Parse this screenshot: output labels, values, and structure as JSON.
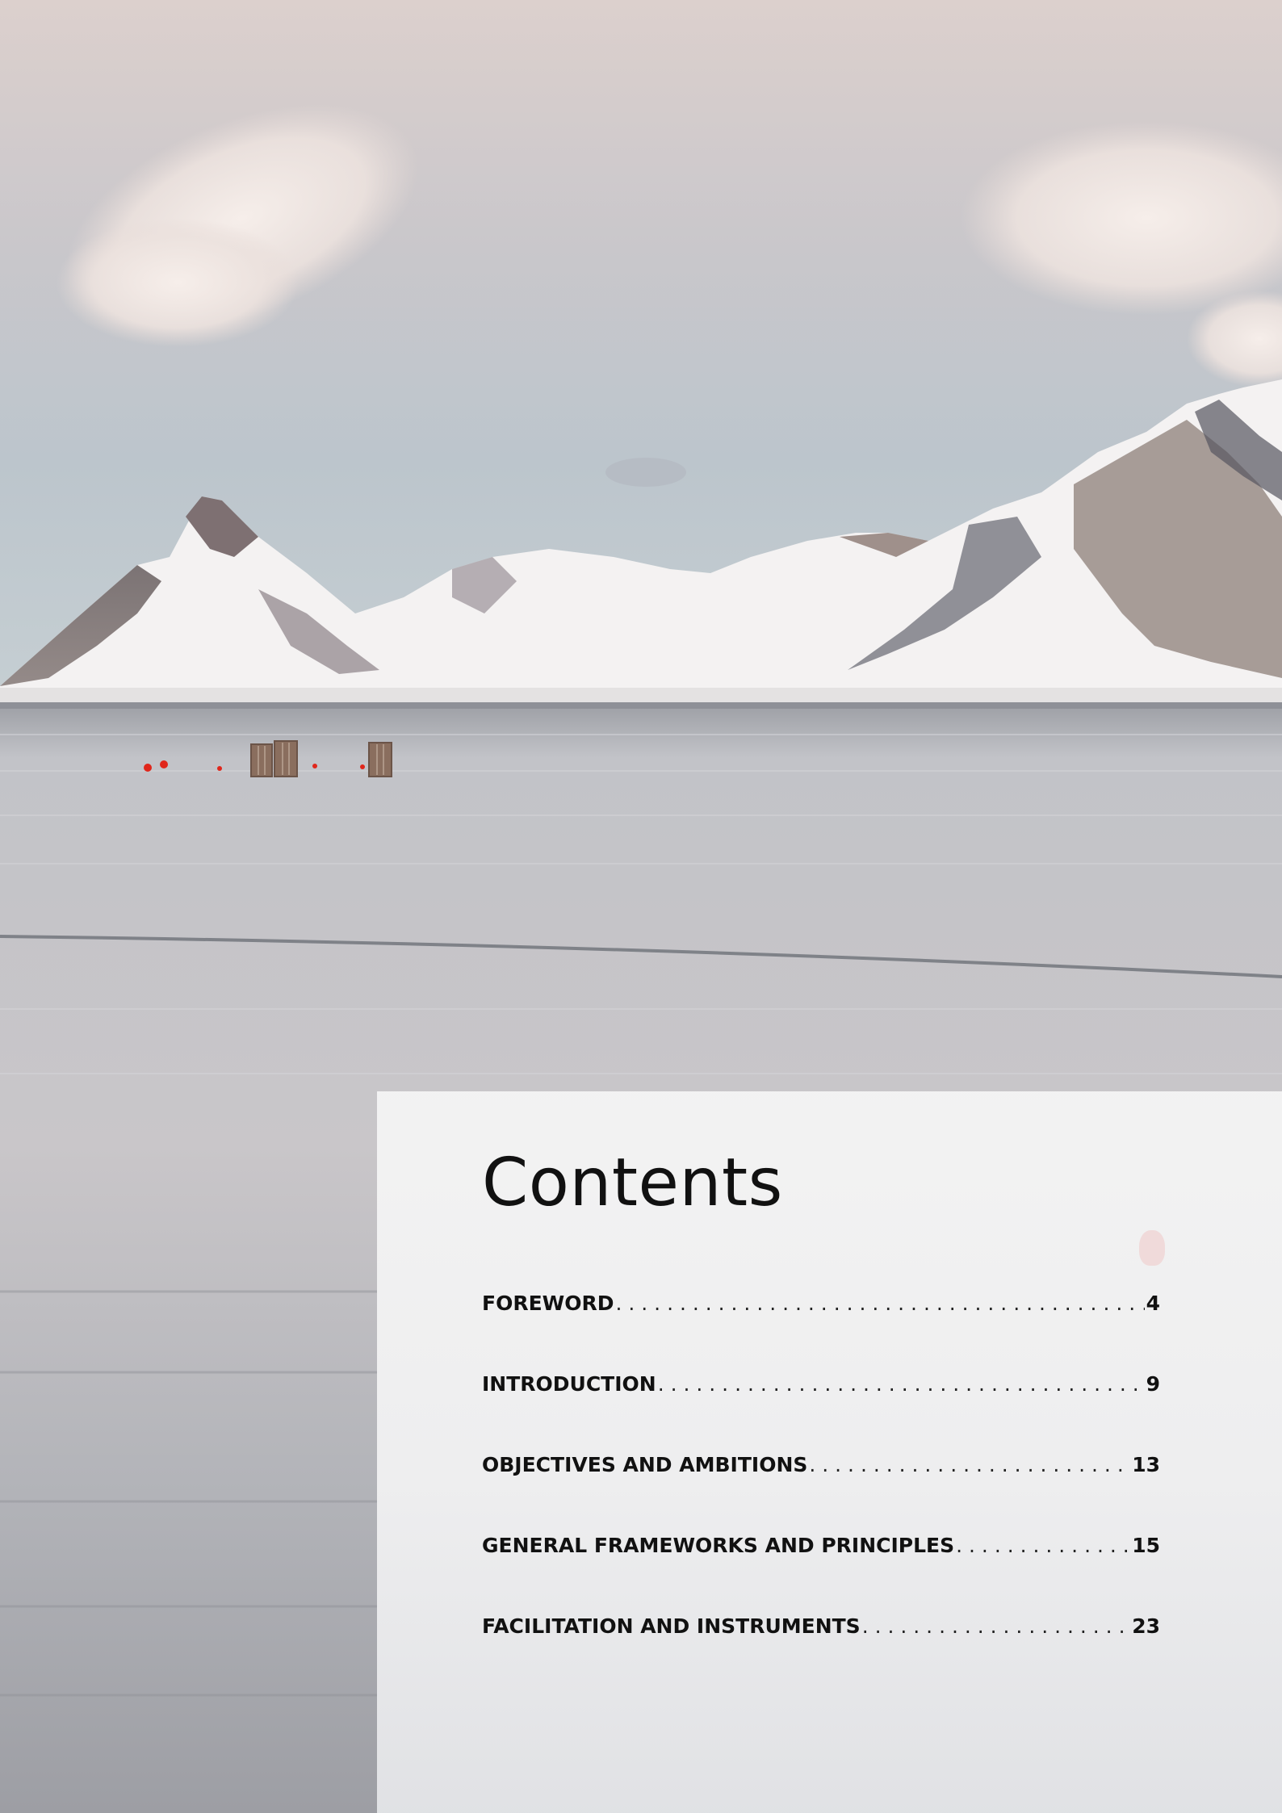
{
  "document": {
    "title": "Contents",
    "toc": [
      {
        "label": "FOREWORD",
        "page": "4"
      },
      {
        "label": "INTRODUCTION",
        "page": "9"
      },
      {
        "label": "OBJECTIVES AND AMBITIONS",
        "page": "13"
      },
      {
        "label": "GENERAL FRAMEWORKS AND PRINCIPLES",
        "page": "15"
      },
      {
        "label": "FACILITATION AND INSTRUMENTS",
        "page": "23"
      }
    ]
  },
  "colors": {
    "sky": "#d8ccc9",
    "water": "#b7b9bf",
    "panel": "#f3f3f3",
    "text": "#111111",
    "buoy": "#e0261b"
  }
}
